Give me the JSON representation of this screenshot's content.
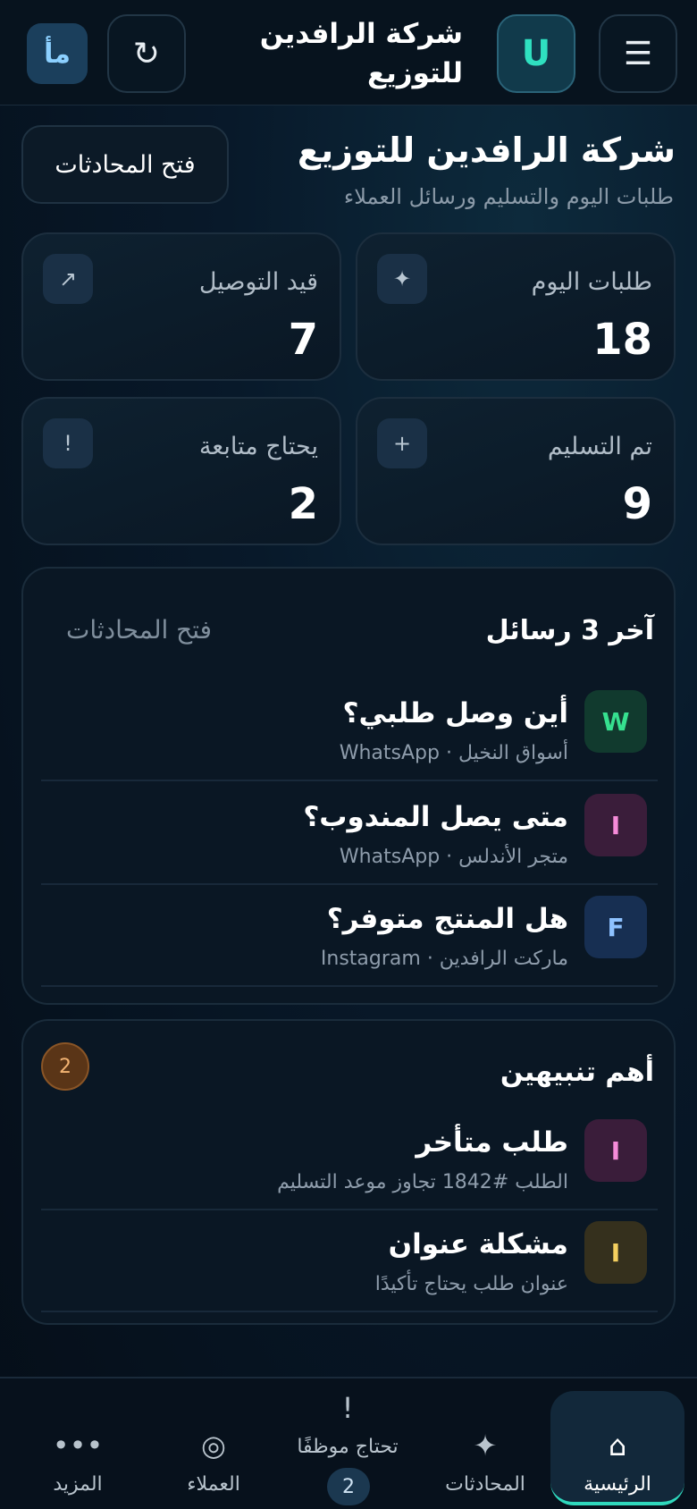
{
  "header": {
    "brand": "شركة الرافدين للتوزيع",
    "logo_letter": "U",
    "avatar_text": "مأ",
    "menu_icon": "☰",
    "refresh_icon": "↻"
  },
  "hero": {
    "title": "شركة الرافدين للتوزيع",
    "subtitle": "طلبات اليوم والتسليم ورسائل العملاء",
    "open_button": "فتح المحادثات"
  },
  "stats": [
    {
      "label": "طلبات اليوم",
      "value": "18",
      "icon": "✦"
    },
    {
      "label": "قيد التوصيل",
      "value": "7",
      "icon": "↗"
    },
    {
      "label": "تم التسليم",
      "value": "9",
      "icon": "+"
    },
    {
      "label": "يحتاج متابعة",
      "value": "2",
      "icon": "!"
    }
  ],
  "messages": {
    "title": "آخر 3 رسائل",
    "link": "فتح المحادثات",
    "items": [
      {
        "title": "أين وصل طلبي؟",
        "sub": "أسواق النخيل · WhatsApp",
        "letter": "W",
        "bg": "#113a2e",
        "fg": "#36e08f"
      },
      {
        "title": "متى يصل المندوب؟",
        "sub": "متجر الأندلس · WhatsApp",
        "letter": "I",
        "bg": "#3a1d3a",
        "fg": "#f58bd8"
      },
      {
        "title": "هل المنتج متوفر؟",
        "sub": "ماركت الرافدين · Instagram",
        "letter": "F",
        "bg": "#172f52",
        "fg": "#8ec2ff"
      }
    ]
  },
  "alerts": {
    "title": "أهم تنبيهين",
    "count": "2",
    "items": [
      {
        "title": "طلب متأخر",
        "sub": "الطلب #1842 تجاوز موعد التسليم",
        "letter": "I",
        "bg": "#3a1d3a",
        "fg": "#f58bd8"
      },
      {
        "title": "مشكلة عنوان",
        "sub": "عنوان طلب يحتاج تأكيدًا",
        "letter": "I",
        "bg": "#35301d",
        "fg": "#f4cf5f"
      }
    ]
  },
  "nav": [
    {
      "label": "الرئيسية",
      "icon": "⌂"
    },
    {
      "label": "المحادثات",
      "icon": "✦"
    },
    {
      "label": "تحتاج موظفًا",
      "icon": "!",
      "badge": "2"
    },
    {
      "label": "العملاء",
      "icon": "◎"
    },
    {
      "label": "المزيد",
      "icon": "•••"
    }
  ]
}
